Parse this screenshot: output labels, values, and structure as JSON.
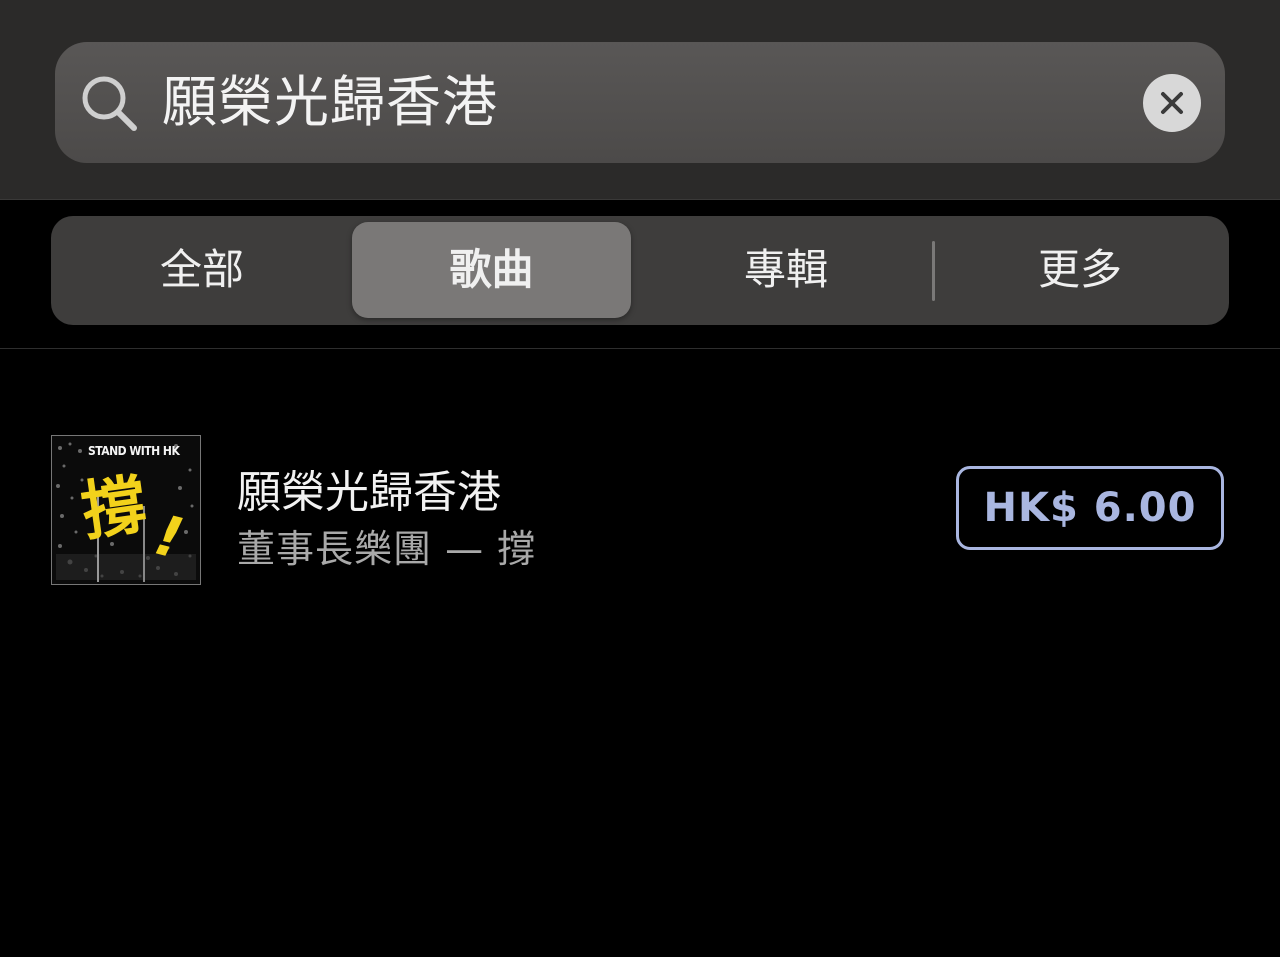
{
  "search": {
    "query": "願榮光歸香港",
    "icon": "search-icon",
    "clear_icon": "clear-icon"
  },
  "segments": {
    "items": [
      {
        "label": "全部",
        "selected": false
      },
      {
        "label": "歌曲",
        "selected": true
      },
      {
        "label": "專輯",
        "selected": false
      },
      {
        "label": "更多",
        "selected": false
      }
    ]
  },
  "result": {
    "title": "願榮光歸香港",
    "subtitle": "董事長樂團 — 撐",
    "price": "HK$ 6.00",
    "artwork": {
      "banner_text": "STAND WITH HK",
      "character": "撐",
      "exclamation": "!"
    }
  },
  "colors": {
    "price_accent": "#a9b6e0",
    "artwork_accent": "#f2d21b"
  }
}
